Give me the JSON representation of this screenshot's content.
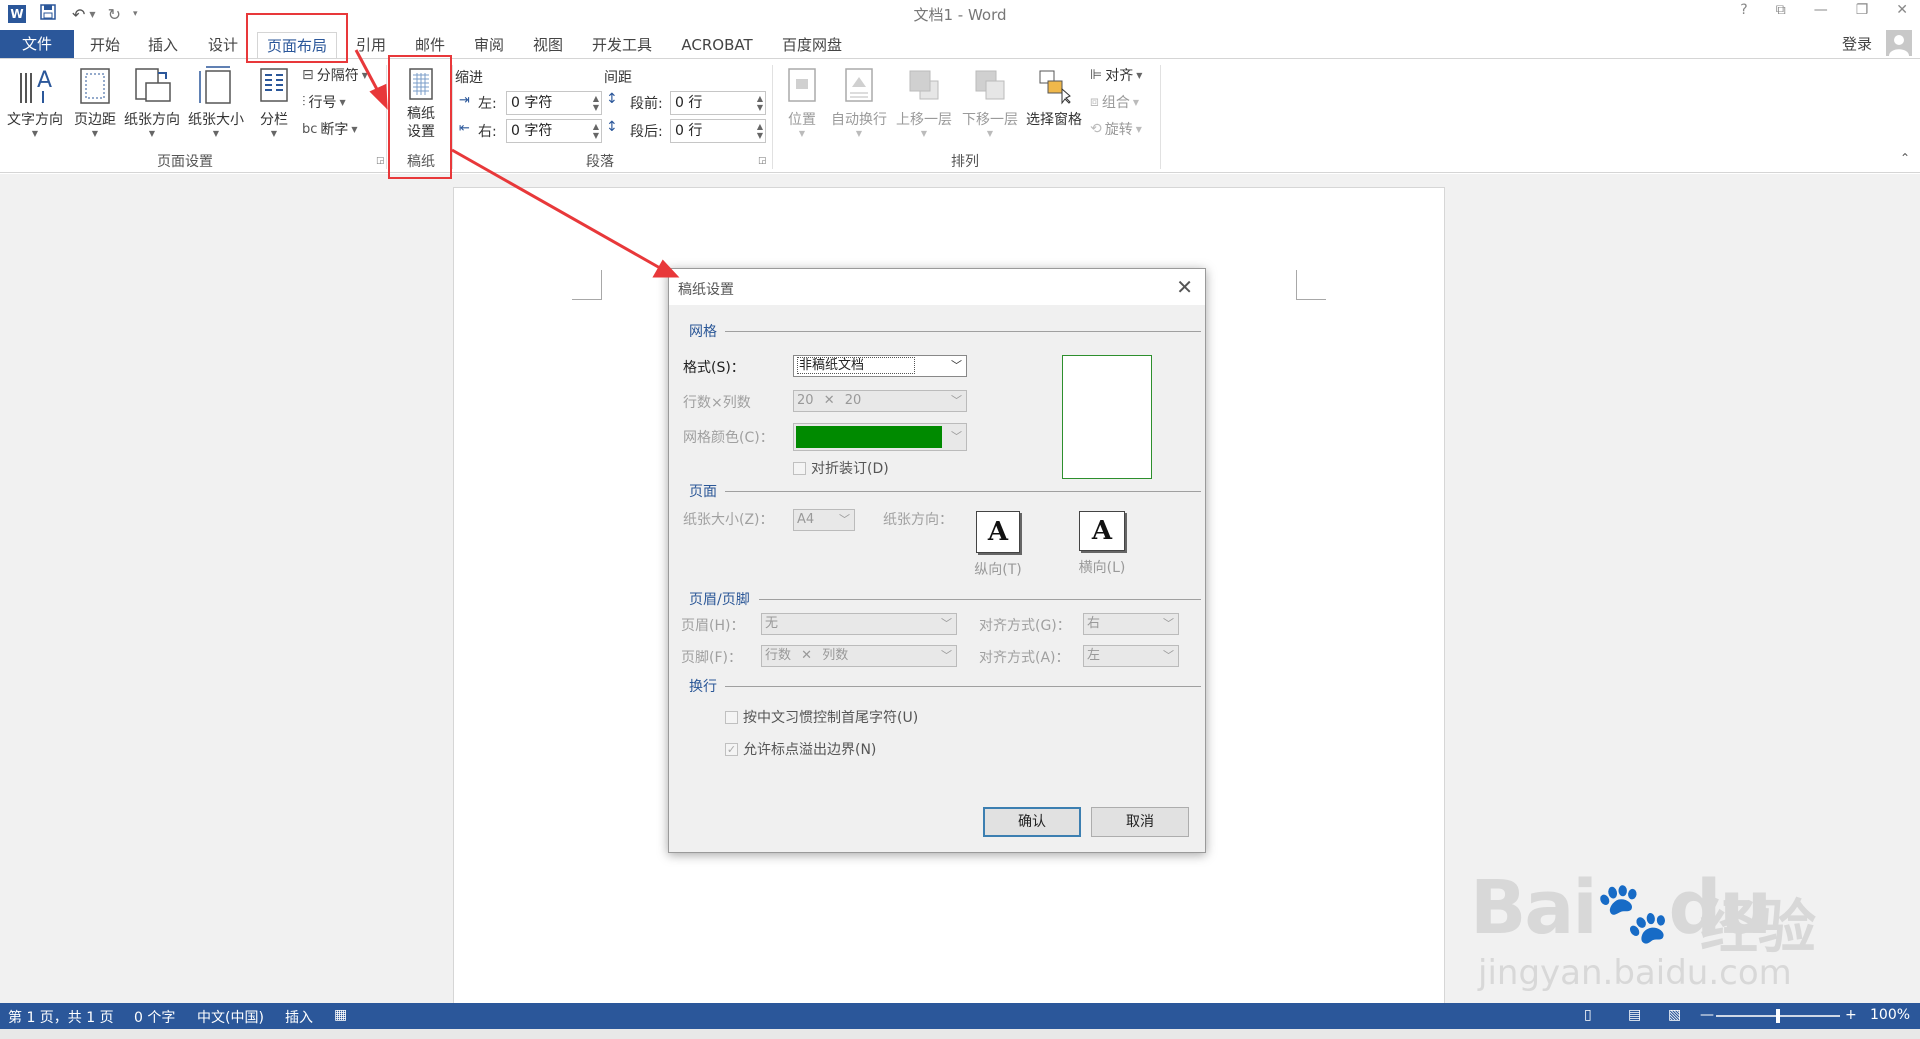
{
  "window": {
    "title": "文档1 - Word",
    "help": "?",
    "controls": [
      "restore-ribbon",
      "minimize",
      "maximize"
    ]
  },
  "tabs": {
    "file": "文件",
    "items": [
      "开始",
      "插入",
      "设计",
      "页面布局",
      "引用",
      "邮件",
      "审阅",
      "视图",
      "开发工具",
      "ACROBAT",
      "百度网盘"
    ],
    "active": "页面布局",
    "login": "登录"
  },
  "ribbon": {
    "page_setup": {
      "text_direction": "文字方向",
      "margins": "页边距",
      "orientation": "纸张方向",
      "size": "纸张大小",
      "columns": "分栏",
      "breaks": "分隔符",
      "line_numbers": "行号",
      "hyphenation": "断字",
      "label": "页面设置"
    },
    "manuscript": {
      "button": "稿纸\n设置",
      "label": "稿纸"
    },
    "paragraph": {
      "indent_label": "缩进",
      "spacing_label": "间距",
      "left_label": "左:",
      "left_value": "0 字符",
      "right_label": "右:",
      "right_value": "0 字符",
      "before_label": "段前:",
      "before_value": "0 行",
      "after_label": "段后:",
      "after_value": "0 行",
      "label": "段落"
    },
    "arrange": {
      "position": "位置",
      "wrap_text": "自动换行",
      "bring_forward": "上移一层",
      "send_backward": "下移一层",
      "selection_pane": "选择窗格",
      "align": "对齐",
      "group": "组合",
      "rotate": "旋转",
      "label": "排列"
    }
  },
  "dialog": {
    "title": "稿纸设置",
    "grid_section": "网格",
    "style_label": "格式(S)：",
    "style_value": "非稿纸文档",
    "rows_cols_label": "行数×列数",
    "rows_cols_value_a": "20",
    "rows_cols_value_b": "20",
    "grid_color_label": "网格颜色(C)：",
    "grid_color": "#008a00",
    "fold_binding": "对折装订(D)",
    "page_section": "页面",
    "paper_size_label": "纸张大小(Z)：",
    "paper_size_value": "A4",
    "orientation_label": "纸张方向：",
    "portrait": "纵向(T)",
    "landscape": "横向(L)",
    "header_footer_section": "页眉/页脚",
    "header_label": "页眉(H)：",
    "header_value": "无",
    "header_align_label": "对齐方式(G)：",
    "header_align_value": "右",
    "footer_label": "页脚(F)：",
    "footer_value_a": "行数",
    "footer_value_b": "列数",
    "footer_align_label": "对齐方式(A)：",
    "footer_align_value": "左",
    "line_break_section": "换行",
    "chinese_rule": "按中文习惯控制首尾字符(U)",
    "allow_punct": "允许标点溢出边界(N)",
    "ok": "确认",
    "cancel": "取消"
  },
  "status": {
    "page": "第 1 页，共 1 页",
    "words": "0 个字",
    "language": "中文(中国)",
    "mode": "插入",
    "zoom": "100%",
    "zoom_fraction": 0.5
  },
  "watermark": {
    "brand": "Bai",
    "brand_tail": "du",
    "cn": "经验",
    "url": "jingyan.baidu.com"
  },
  "colors": {
    "accent": "#2b579a",
    "annotation": "#e8383a"
  }
}
